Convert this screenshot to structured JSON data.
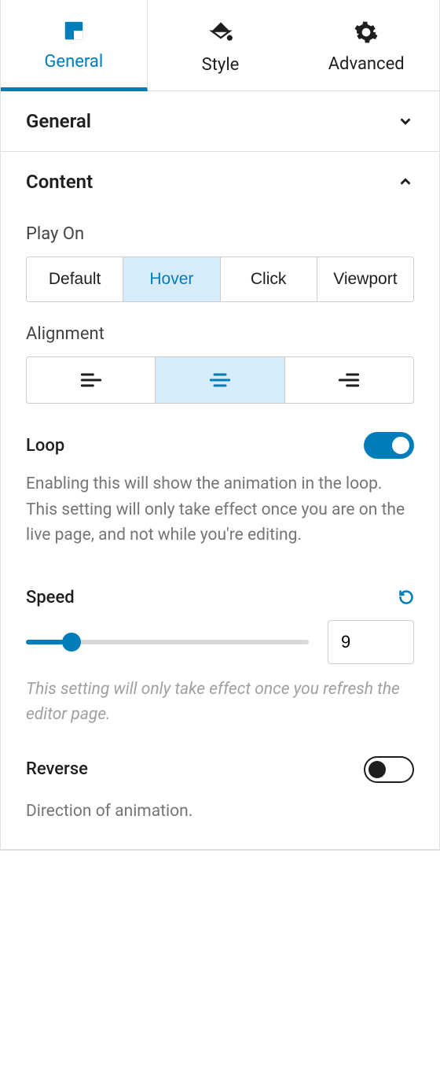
{
  "tabs": {
    "general": "General",
    "style": "Style",
    "advanced": "Advanced"
  },
  "sections": {
    "general": {
      "title": "General"
    },
    "content": {
      "title": "Content",
      "play_on": {
        "label": "Play On",
        "options": {
          "default": "Default",
          "hover": "Hover",
          "click": "Click",
          "viewport": "Viewport"
        }
      },
      "alignment": {
        "label": "Alignment"
      },
      "loop": {
        "label": "Loop",
        "enabled": true,
        "help": "Enabling this will show the animation in the loop. This setting will only take effect once you are on the live page, and not while you're editing."
      },
      "speed": {
        "label": "Speed",
        "value": "9",
        "help": "This setting will only take effect once you refresh the editor page."
      },
      "reverse": {
        "label": "Reverse",
        "enabled": false,
        "help": "Direction of animation."
      }
    }
  }
}
